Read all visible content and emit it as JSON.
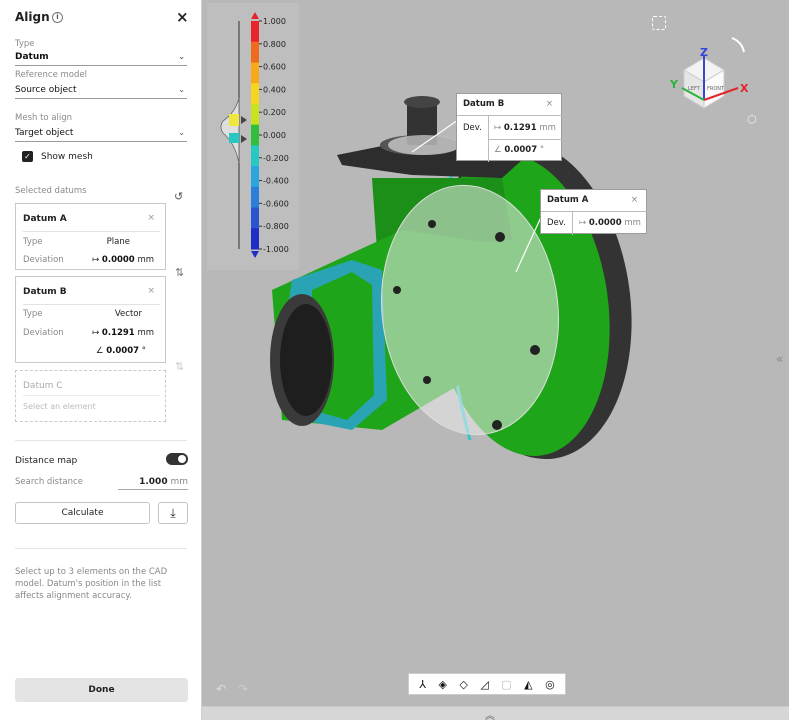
{
  "panel": {
    "title": "Align",
    "info_icon": "info-icon",
    "close_icon": "×",
    "type_label": "Type",
    "type_value": "Datum",
    "ref_label": "Reference model",
    "ref_value": "Source object",
    "mesh_label": "Mesh to align",
    "mesh_value": "Target object",
    "show_mesh_label": "Show mesh",
    "show_mesh_checked": true,
    "selected_datums_label": "Selected datums",
    "datum_a": {
      "title": "Datum A",
      "type_label": "Type",
      "type_value": "Plane",
      "dev_label": "Deviation",
      "dev_symbol": "↦",
      "dev_value": "0.0000",
      "dev_unit": "mm"
    },
    "datum_b": {
      "title": "Datum B",
      "type_label": "Type",
      "type_value": "Vector",
      "dev_label": "Deviation",
      "dev_symbol": "↦",
      "dev_value": "0.1291",
      "dev_unit": "mm",
      "angle_symbol": "∠",
      "angle_value": "0.0007",
      "angle_unit": "°"
    },
    "datum_c": {
      "title": "Datum C",
      "placeholder": "Select an element"
    },
    "distance_map_label": "Distance map",
    "distance_map_on": true,
    "search_distance_label": "Search distance",
    "search_distance_value": "1.000",
    "search_distance_unit": "mm",
    "calculate_label": "Calculate",
    "hint": "Select up to 3 elements on the CAD model. Datum's position in the list affects alignment accuracy.",
    "done_label": "Done"
  },
  "scale_ticks": [
    "1.000",
    "0.800",
    "0.600",
    "0.400",
    "0.200",
    "0.000",
    "-0.200",
    "-0.400",
    "-0.600",
    "-0.800",
    "-1.000"
  ],
  "scale_colors": [
    "#e8232a",
    "#ee6a1e",
    "#f7a81b",
    "#f7d41d",
    "#c9e21f",
    "#2fbf3a",
    "#27c7c4",
    "#2aa6de",
    "#2a7fd8",
    "#2a55d0",
    "#1f2fc4"
  ],
  "callout_b": {
    "title": "Datum B",
    "dev_label": "Dev.",
    "dev_symbol": "↦",
    "dev_value": "0.1291",
    "dev_unit": "mm",
    "angle_symbol": "∠",
    "angle_value": "0.0007",
    "angle_unit": "°"
  },
  "callout_a": {
    "title": "Datum A",
    "dev_label": "Dev.",
    "dev_symbol": "↦",
    "dev_value": "0.0000",
    "dev_unit": "mm"
  },
  "viewcube": {
    "axis_z": "Z",
    "axis_y": "Y",
    "axis_x": "X",
    "face_left": "LEFT",
    "face_front": "FRONT"
  },
  "colors": {
    "green": "#1fa51a",
    "gray": "#3c3c3c",
    "cyan": "#35c4d4"
  }
}
